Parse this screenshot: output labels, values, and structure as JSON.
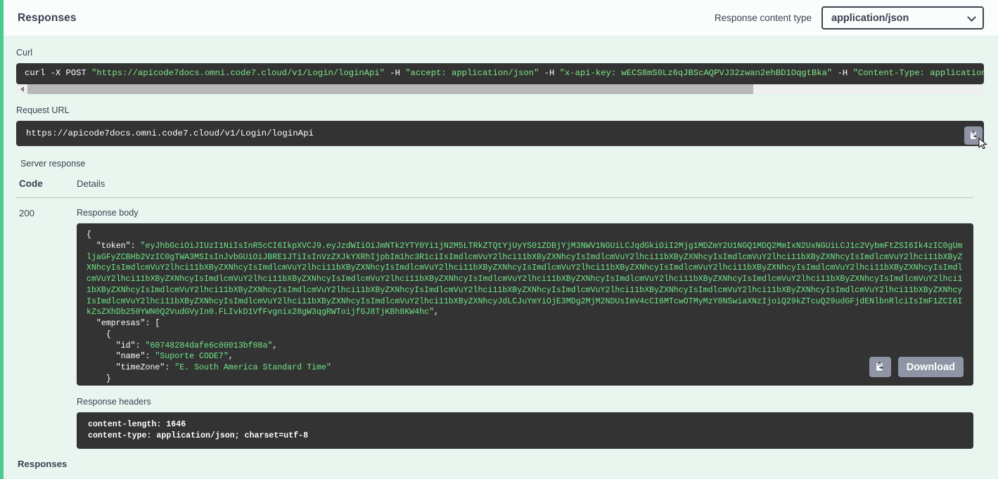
{
  "header": {
    "title": "Responses",
    "content_type_label": "Response content type",
    "content_type_value": "application/json",
    "chevron_icon": "chevron-down-icon"
  },
  "curl": {
    "label": "Curl",
    "command": "curl -X POST \"https://apicode7docs.omni.code7.cloud/v1/Login/loginApi\" -H  \"accept: application/json\" -H  \"x-api-key: wECS8mS0Lz6qJBScAQPVJ32zwan2ehBD1OqgtBka\" -H  \"Content-Type: application/json\" -d \"{  \\\"lo",
    "copy_icon": "copy-icon"
  },
  "request_url": {
    "label": "Request URL",
    "url": "https://apicode7docs.omni.code7.cloud/v1/Login/loginApi"
  },
  "server_response": {
    "label": "Server response",
    "columns": [
      "Code",
      "Details"
    ],
    "code": "200",
    "response_body_label": "Response body",
    "response_headers_label": "Response headers",
    "response_body": "{\n  \"token\": \"eyJhbGciOiJIUzI1NiIsInR5cCI6IkpXVCJ9.eyJzdWIiOiJmNTk2YTY0Yi1jN2M5LTRkZTQtYjUyYS01ZDBjYjM3NWV1NGUiLCJqdGkiOiI2Mjg1MDZmY2U1NGQ1MDQ2MmIxN2UxNGUiLCJ1c2VybmFtZSI6Ik4zIC0gUmljaGFyZCBHb2VzIC0gTWA3MSIsInJvbGUiOiJBRE1JTiIsInVzZXJkYXRhIjpbIm1hc3R1ciIsImdlcmVuY2lhci11bXByZXNhcyIsImdlcmVuY2lhci11bXByZXNhcyIsImdlcmVuY2lhci11bXByZXNhcyIsImdlcmVuY2lhci11bXByZXNhcyIsImdlcmVuY2lhci11bXByZXNhcyIsImdlcmVuY2lhci11bXByZXNhcyIsImdlcmVuY2lhci11bXByZXNhcyIsImdlcmVuY2lhci11bXByZXNhcyIsImdlcmVuY2lhci11bXByZXNhcyIsImdlcmVuY2lhci11bXByZXNhcyIsImdlcmVuY2lhci11bXByZXNhcyIsImdlcmVuY2lhci11bXByZXNhcyIsImdlcmVuY2lhci11bXByZXNhcyIsImdlcmVuY2lhci11bXByZXNhcyIsImdlcmVuY2lhci11bXByZXNhcyIsImdlcmVuY2lhci11bXByZXNhcyIsImdlcmVuY2lhci11bXByZXNhcyIsImdlcmVuY2lhci11bXByZXNhcyIsImdlcmVuY2lhci11bXByZXNhcyIsImdlcmVuY2lhci11bXByZXNhcyIsImdlcmVuY2lhci11bXByZXNhcyIsImdlcmVuY2lhci11bXByZXNhcyIsImdlcmVuY2lhci11bXByZXNhcyIsImdlcmVuY2lhci11bXByZXNhcyIsImdlcmVuY2lhci11bXByZXNhcyIsImdlcmVuY2lhci11bXByZXNhcyJdLCJuYmYiOjE3MDg2MjM2NDUsImV4cCI6MTcwOTMyMzY0NSwiaXNzIjoiQ29kZTcuQ29udGFjdENlbnRlciIsImF1ZCI6IkZsZXhDb250YWN0Q2VudGVyIn0.FLIvkD1VfFvgnix28gW3qgRWToijfGJ8TjKBh8KW4hc\",\n  \"empresas\": [\n    {\n      \"id\": \"60748284dafe6c00013bf08a\",\n      \"name\": \"Suporte CODE7\",\n      \"timeZone\": \"E. South America Standard Time\"\n    }\n  ]\n}",
    "response_headers": "content-length: 1646\ncontent-type: application/json; charset=utf-8",
    "copy_icon": "copy-icon",
    "download_label": "Download"
  },
  "footer": {
    "responses_label": "Responses"
  },
  "colors": {
    "accent_green": "#49cc90",
    "body_background": "#e8f6ef",
    "code_background": "#333333",
    "code_text_green": "#6ee787",
    "button_gray": "#8f95a5",
    "text_dark": "#3b4151"
  }
}
